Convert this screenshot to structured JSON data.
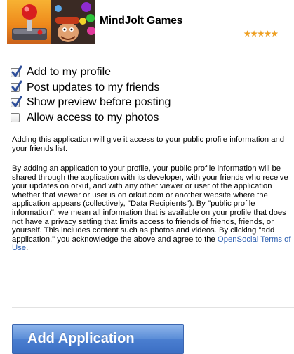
{
  "app": {
    "name": "MindJolt Games",
    "rating_stars": "★★★★★"
  },
  "permissions": [
    {
      "label": "Add to my profile",
      "checked": true
    },
    {
      "label": "Post updates to my friends",
      "checked": true
    },
    {
      "label": "Show preview before posting",
      "checked": true
    },
    {
      "label": "Allow access to my photos",
      "checked": false
    }
  ],
  "notice": {
    "intro": "Adding this application will give it access to your public profile information and your friends list.",
    "disclaimer_before_link": "By adding an application to your profile, your public profile information will be shared through the application with its developer, with your friends who receive your updates on orkut, and with any other viewer or user of the application whether that viewer or user is on orkut.com or another website where the application appears (collectively, \"Data Recipients\"). By \"public profile information\", we mean all information that is available on your profile that does not have a privacy setting that limits access to friends of friends, friends, or yourself. This includes content such as photos and videos. By clicking \"add application,\" you acknowledge the above and agree to the ",
    "terms_link": "OpenSocial Terms of Use",
    "disclaimer_after_link": "."
  },
  "add_button_label": "Add Application",
  "colors": {
    "link": "#2a5db0",
    "button": "#4a7ed0",
    "check": "#2f4f9a",
    "stars": "#f0a020"
  }
}
